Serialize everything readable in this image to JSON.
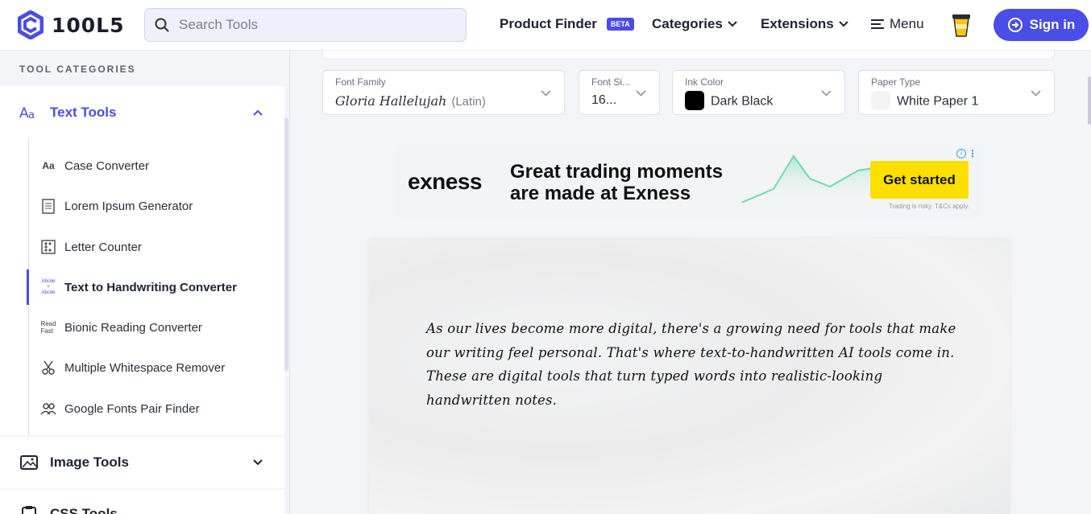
{
  "header": {
    "logo_text": "100L5",
    "search_placeholder": "Search Tools",
    "product_finder": "Product Finder",
    "beta_badge": "BETA",
    "categories": "Categories",
    "extensions": "Extensions",
    "menu": "Menu",
    "sign_in": "Sign in",
    "accent_color": "#4a4de6"
  },
  "sidebar": {
    "heading": "TOOL CATEGORIES",
    "text_tools": "Text Tools",
    "text_tools_items": [
      {
        "label": "Case Converter",
        "icon": "Aa"
      },
      {
        "label": "Lorem Ipsum Generator",
        "icon": "notepad"
      },
      {
        "label": "Letter Counter",
        "icon": "abacus"
      },
      {
        "label": "Text to Handwriting Converter",
        "icon": "Abcde",
        "active": true
      },
      {
        "label": "Bionic Reading Converter",
        "icon": "Read Fast"
      },
      {
        "label": "Multiple Whitespace Remover",
        "icon": "scissors"
      },
      {
        "label": "Google Fonts Pair Finder",
        "icon": "people"
      }
    ],
    "image_tools": "Image Tools",
    "css_tools": "CSS Tools"
  },
  "controls": {
    "font_family_label": "Font Family",
    "font_family_value": "Gloria Hallelujah",
    "font_family_subset": "(Latin)",
    "font_size_label": "Font Si...",
    "font_size_value": "16...",
    "ink_color_label": "Ink Color",
    "ink_color_value": "Dark Black",
    "ink_color_hex": "#000000",
    "paper_type_label": "Paper Type",
    "paper_type_value": "White Paper 1"
  },
  "ad": {
    "brand": "exness",
    "headline_line1": "Great trading moments",
    "headline_line2": "are made at Exness",
    "button": "Get started",
    "disclaimer": "Trading is risky. T&Cs apply.",
    "info_icon": "i"
  },
  "paper": {
    "text": "As our lives become more digital, there's a growing need for tools that make our writing feel personal. That's where text-to-handwritten AI tools come in. These are digital tools that turn typed words into realistic-looking handwritten notes."
  }
}
